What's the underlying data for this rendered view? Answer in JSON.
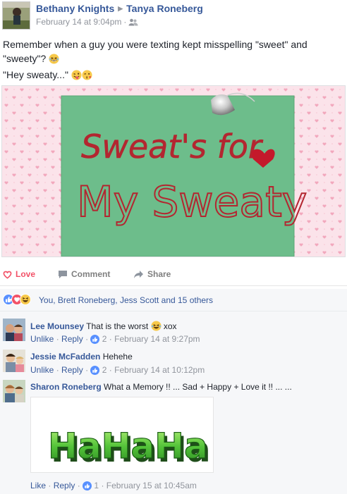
{
  "post": {
    "author": "Bethany Knights",
    "target": "Tanya Roneberg",
    "timestamp": "February 14 at 9:04pm",
    "separator": "·",
    "audience_icon": "friends-icon",
    "text_line1": "Remember when a guy you were texting kept misspelling \"sweet\" and",
    "text_line2": "\"sweety\"?",
    "text_line3": "\"Hey sweaty...\"",
    "image": {
      "line1": "Sweat's for",
      "line2": "My Sweaty",
      "background": "#fde7ee",
      "paper": "#6fbe8e",
      "ink": "#b32630"
    }
  },
  "actions": {
    "love_label": "Love",
    "comment_label": "Comment",
    "share_label": "Share",
    "love_color": "#f25268"
  },
  "reactions": {
    "summary": "You, Brett Roneberg, Jess Scott and 15 others"
  },
  "comments": [
    {
      "author": "Lee Mounsey",
      "text_before": "That is the worst",
      "text_after": "xox",
      "like_label": "Unlike",
      "reply_label": "Reply",
      "likes": "2",
      "time": "February 14 at 9:27pm",
      "sep": "·"
    },
    {
      "author": "Jessie McFadden",
      "text": "Hehehe",
      "like_label": "Unlike",
      "reply_label": "Reply",
      "likes": "2",
      "time": "February 14 at 10:12pm",
      "sep": "·"
    },
    {
      "author": "Sharon Roneberg",
      "text": "What a Memory !! ... Sad + Happy + Love it !! ... ...",
      "gif_text": "HaHaHa",
      "like_label": "Like",
      "reply_label": "Reply",
      "likes": "1",
      "time": "February 15 at 10:45am",
      "sep": "·"
    }
  ],
  "colors": {
    "link": "#365899",
    "muted": "#90949c",
    "like_blue": "#5890ff",
    "haha_yellow": "#f7c94a"
  }
}
